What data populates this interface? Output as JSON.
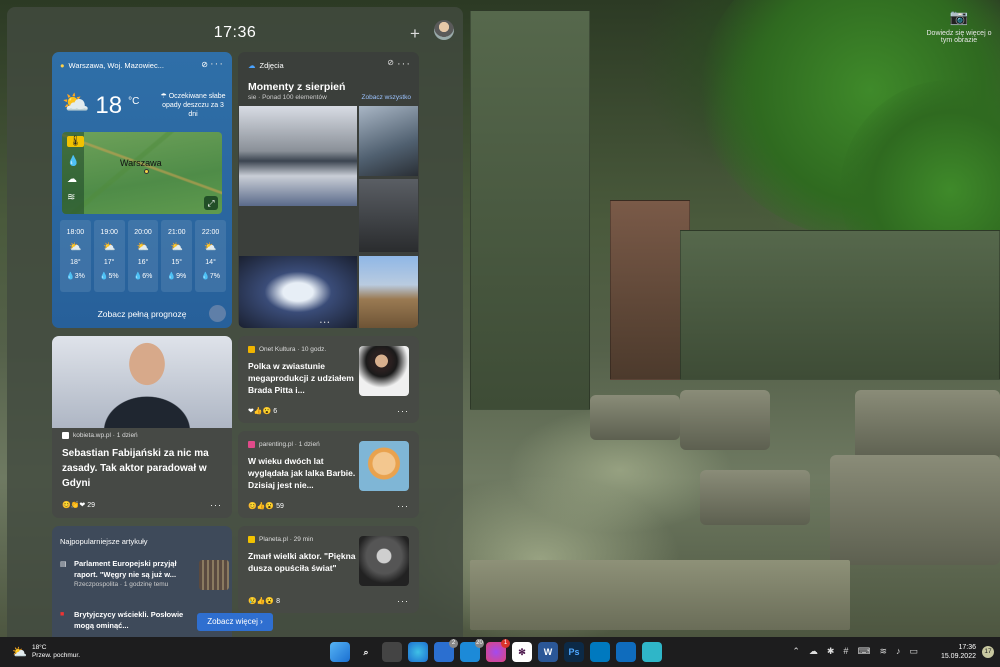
{
  "widgets": {
    "clock": "17:36",
    "weather": {
      "location": "Warszawa, Woj. Mazowiec...",
      "temp": "18",
      "unit": "°C",
      "forecast": "Oczekiwane słabe opady deszczu za 3 dni",
      "map_city": "Warszawa",
      "hours": [
        {
          "time": "18:00",
          "temp": "18°",
          "rain": "3%"
        },
        {
          "time": "19:00",
          "temp": "17°",
          "rain": "5%"
        },
        {
          "time": "20:00",
          "temp": "16°",
          "rain": "6%"
        },
        {
          "time": "21:00",
          "temp": "15°",
          "rain": "9%"
        },
        {
          "time": "22:00",
          "temp": "14°",
          "rain": "7%"
        }
      ],
      "see_forecast": "Zobacz pełną prognozę"
    },
    "photos": {
      "app": "Zdjęcia",
      "title": "Momenty z sierpień",
      "subtitle": "sie · Ponad 100 elementów",
      "see_all": "Zobacz wszystko"
    },
    "big_news": {
      "source": "kobieta.wp.pl · 1 dzień",
      "title": "Sebastian Fabijański za nic ma zasady. Tak aktor paradował w Gdyni",
      "reactions": "29"
    },
    "news": [
      {
        "source": "Onet Kultura · 10 godz.",
        "title": "Polka w zwiastunie megaprodukcji z udziałem Brada Pitta i...",
        "reactions": "6",
        "logo_color": "#f0b400"
      },
      {
        "source": "parenting.pl · 1 dzień",
        "title": "W wieku dwóch lat wyglądała jak lalka Barbie. Dzisiaj jest nie...",
        "reactions": "59",
        "logo_color": "#e04a8a"
      },
      {
        "source": "Planeta.pl · 29 min",
        "title": "Zmarł wielki aktor. \"Piękna dusza opuściła świat\"",
        "reactions": "8",
        "logo_color": "#f2c200"
      }
    ],
    "top_articles": {
      "heading": "Najpopularniejsze artykuły",
      "items": [
        {
          "title": "Parlament Europejski przyjął raport. \"Węgry nie są już w...",
          "source": "Rzeczpospolita · 1 godzinę temu"
        },
        {
          "title": "Brytyjczycy wściekli. Posłowie mogą ominąć...",
          "source": ""
        }
      ]
    },
    "see_more": "Zobacz więcej"
  },
  "desktop": {
    "caption": "Dowiedz się więcej o tym obrazie"
  },
  "taskbar": {
    "weather_temp": "18°C",
    "weather_desc": "Przew. pochmur.",
    "apps": [
      {
        "name": "windows-start",
        "label": "",
        "color": "#3a8ee6",
        "badge": ""
      },
      {
        "name": "search",
        "label": "",
        "color": "#1d1d1e",
        "badge": ""
      },
      {
        "name": "task-view",
        "label": "",
        "color": "#555",
        "badge": ""
      },
      {
        "name": "edge",
        "label": "",
        "color": "#2a9ad4",
        "badge": ""
      },
      {
        "name": "mail",
        "label": "",
        "color": "#2b6fd0",
        "badge": "2"
      },
      {
        "name": "calendar-app",
        "label": "",
        "color": "#1c8ad8",
        "badge": "20"
      },
      {
        "name": "messenger",
        "label": "",
        "color": "#a24bf0",
        "badge": "1"
      },
      {
        "name": "slack",
        "label": "",
        "color": "#4a154b",
        "badge": ""
      },
      {
        "name": "word",
        "label": "W",
        "color": "#2b5797",
        "badge": ""
      },
      {
        "name": "photoshop",
        "label": "Ps",
        "color": "#0c2a47",
        "badge": ""
      },
      {
        "name": "trello",
        "label": "",
        "color": "#0079bf",
        "badge": ""
      },
      {
        "name": "outlook",
        "label": "",
        "color": "#0f6cbd",
        "badge": ""
      },
      {
        "name": "store",
        "label": "",
        "color": "#2fb6c8",
        "badge": ""
      }
    ],
    "time": "17:36",
    "date": "15.09.2022",
    "notification_count": "17"
  }
}
